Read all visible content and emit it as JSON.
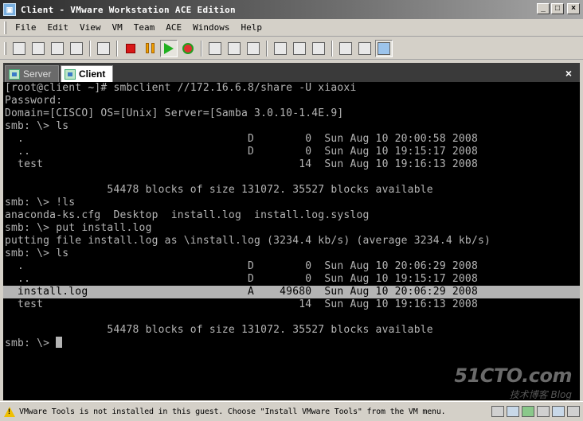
{
  "window": {
    "title": "Client - VMware Workstation ACE Edition",
    "controls": {
      "minimize": "_",
      "maximize": "□",
      "close": "×"
    }
  },
  "menu": [
    "File",
    "Edit",
    "View",
    "VM",
    "Team",
    "ACE",
    "Windows",
    "Help"
  ],
  "tabs": [
    {
      "label": "Server",
      "active": false
    },
    {
      "label": "Client",
      "active": true
    }
  ],
  "tab_close": "×",
  "console": {
    "lines": [
      "[root@client ~]# smbclient //172.16.6.8/share -U xiaoxi",
      "Password:",
      "Domain=[CISCO] OS=[Unix] Server=[Samba 3.0.10-1.4E.9]",
      "smb: \\> ls",
      "  .                                   D        0  Sun Aug 10 20:00:58 2008",
      "  ..                                  D        0  Sun Aug 10 19:15:17 2008",
      "  test                                        14  Sun Aug 10 19:16:13 2008",
      "",
      "                54478 blocks of size 131072. 35527 blocks available",
      "smb: \\> !ls",
      "anaconda-ks.cfg  Desktop  install.log  install.log.syslog",
      "smb: \\> put install.log",
      "putting file install.log as \\install.log (3234.4 kb/s) (average 3234.4 kb/s)",
      "smb: \\> ls",
      "  .                                   D        0  Sun Aug 10 20:06:29 2008",
      "  ..                                  D        0  Sun Aug 10 19:15:17 2008",
      "  install.log                         A    49680  Sun Aug 10 20:06:29 2008",
      "  test                                        14  Sun Aug 10 19:16:13 2008",
      "",
      "                54478 blocks of size 131072. 35527 blocks available",
      "smb: \\> "
    ],
    "highlighted_line_index": 16
  },
  "watermark": {
    "main": "51CTO.com",
    "sub": "技术博客  Blog"
  },
  "status": {
    "message": "VMware Tools is not installed in this guest. Choose \"Install VMware Tools\" from the VM menu."
  },
  "colors": {
    "console_bg": "#000000",
    "console_fg": "#b4b4b4",
    "chrome": "#d4d0c8"
  }
}
